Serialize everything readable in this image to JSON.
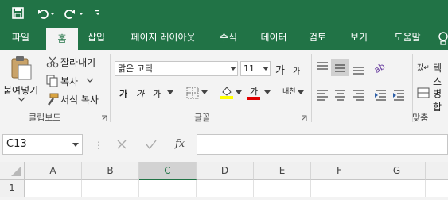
{
  "qat": {
    "save_icon": "save-icon",
    "undo_icon": "undo-icon",
    "redo_icon": "redo-icon",
    "customize_icon": "customize-qat-icon"
  },
  "tabs": [
    "파일",
    "홈",
    "삽입",
    "페이지 레이아웃",
    "수식",
    "데이터",
    "검토",
    "보기",
    "도움말"
  ],
  "clipboard": {
    "paste": "붙여넣기",
    "cut": "잘라내기",
    "copy": "복사",
    "format_painter": "서식 복사",
    "label": "클립보드"
  },
  "font": {
    "name": "맑은 고딕",
    "size": "11",
    "grow": "가",
    "shrink": "가",
    "bold": "가",
    "italic": "가",
    "underline": "가",
    "highlight": "가",
    "fontcolor": "가",
    "phonetic": "내천",
    "label": "글꼴"
  },
  "alignment": {
    "wrap": "텍스",
    "merge": "병합",
    "label": "맞춤"
  },
  "colors": {
    "accent": "#217346",
    "highlight": "#ffff00",
    "font_color": "#e00000"
  },
  "formula": {
    "cell_ref": "C13",
    "fx": "fx",
    "value": ""
  },
  "columns": [
    "A",
    "B",
    "C",
    "D",
    "E",
    "F",
    "G"
  ],
  "selected_column": "C",
  "row": "1"
}
